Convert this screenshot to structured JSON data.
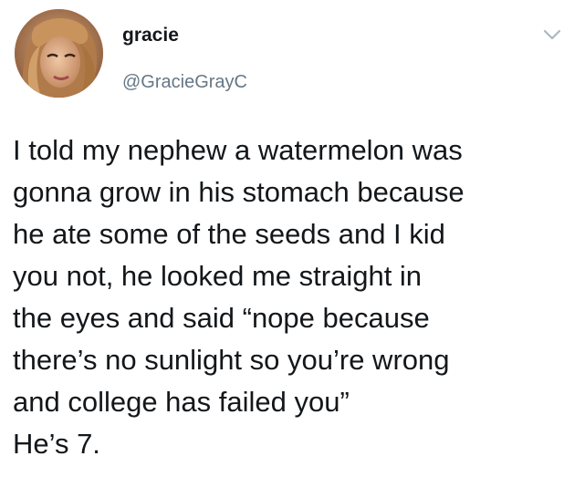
{
  "tweet": {
    "author": {
      "display_name": "gracie",
      "handle": "@GracieGrayC"
    },
    "menu_icon": "chevron-down-icon",
    "text_lines": [
      "I told my nephew a watermelon was",
      "gonna grow in his stomach because",
      "he ate some of the seeds and I kid",
      "you not, he looked me straight in",
      "the eyes and said “nope because",
      "there’s no sunlight so you’re wrong",
      "and college has failed you”",
      "He’s 7."
    ]
  },
  "colors": {
    "text": "#14171a",
    "handle": "#657786",
    "chevron": "#aab8c2",
    "background": "#ffffff"
  }
}
